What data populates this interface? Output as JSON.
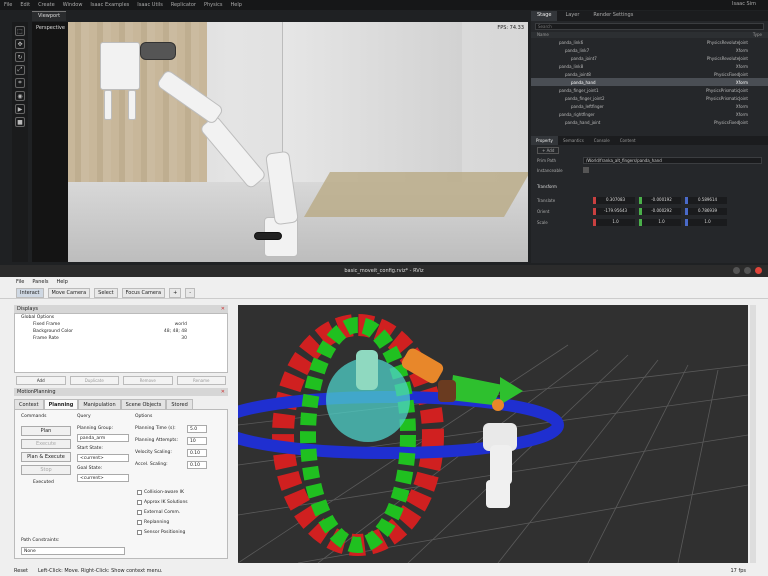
{
  "sim": {
    "menu": [
      "File",
      "Edit",
      "Create",
      "Window",
      "Isaac Examples",
      "Isaac Utils",
      "Replicator",
      "Physics",
      "Help"
    ],
    "menu_right": [
      "Isaac Sim"
    ],
    "viewport_tab": "Viewport",
    "viewport_camera": "Perspective",
    "viewport_fps": "FPS: 74.33",
    "tools": [
      "select",
      "move",
      "rotate",
      "scale",
      "snap",
      "camera",
      "play",
      "stop"
    ],
    "stage": {
      "tabs": [
        "Stage",
        "Layer",
        "Render Settings"
      ],
      "active_tab": "Stage",
      "search_placeholder": "Search",
      "col_name": "Name",
      "col_type": "Type",
      "rows": [
        {
          "name": "panda_link6",
          "type": "PhysicsRevoluteJoint",
          "sel": false
        },
        {
          "name": "panda_link7",
          "type": "Xform",
          "sel": false
        },
        {
          "name": "panda_joint7",
          "type": "PhysicsRevoluteJoint",
          "sel": false
        },
        {
          "name": "panda_link8",
          "type": "Xform",
          "sel": false
        },
        {
          "name": "panda_joint8",
          "type": "PhysicsFixedJoint",
          "sel": false
        },
        {
          "name": "panda_hand",
          "type": "Xform",
          "sel": true
        },
        {
          "name": "panda_finger_joint1",
          "type": "PhysicsPrismaticJoint",
          "sel": false
        },
        {
          "name": "panda_finger_joint2",
          "type": "PhysicsPrismaticJoint",
          "sel": false
        },
        {
          "name": "panda_leftfinger",
          "type": "Xform",
          "sel": false
        },
        {
          "name": "panda_rightfinger",
          "type": "Xform",
          "sel": false
        },
        {
          "name": "panda_hand_joint",
          "type": "PhysicsFixedJoint",
          "sel": false
        }
      ]
    },
    "property": {
      "tabs": [
        "Property",
        "Semantics",
        "Console",
        "Content"
      ],
      "active_tab": "Property",
      "add_button": "+ Add",
      "name_label": "Prim Path",
      "name_value": "/World/franka_alt_fingers/panda_hand",
      "instanceable_label": "Instanceable",
      "transform_section": "Transform",
      "translate_label": "Translate",
      "orient_label": "Orient",
      "scale_label": "Scale",
      "translate": [
        "0.307083",
        "-0.000192",
        "0.589614"
      ],
      "orient": [
        "-179.95643",
        "-0.000292",
        "0.786939"
      ],
      "scale": [
        "1.0",
        "1.0",
        "1.0"
      ]
    }
  },
  "rviz": {
    "title": "basic_moveit_config.rviz* - RViz",
    "menu": [
      "File",
      "Panels",
      "Help"
    ],
    "tools": [
      "Interact",
      "Move Camera",
      "Select",
      "Focus Camera",
      "+",
      "-"
    ],
    "displays_title": "Displays",
    "displays": [
      {
        "name": "Global Options",
        "value": ""
      },
      {
        "name": "Fixed Frame",
        "value": "world"
      },
      {
        "name": "Background Color",
        "value": "48; 48; 48"
      },
      {
        "name": "Frame Rate",
        "value": "30"
      }
    ],
    "display_buttons": [
      "Add",
      "Duplicate",
      "Remove",
      "Rename"
    ],
    "motion_title": "MotionPlanning",
    "mp_tabs": [
      "Context",
      "Planning",
      "Manipulation",
      "Scene Objects",
      "Stored"
    ],
    "mp_active_tab": "Planning",
    "commands_label": "Commands",
    "query_label": "Query",
    "options_label": "Options",
    "plan_button": "Plan",
    "execute_button": "Execute",
    "plan_execute_button": "Plan & Execute",
    "stop_button": "Stop",
    "executed_label": "Executed",
    "planning_group_label": "Planning Group:",
    "planning_group_value": "panda_arm",
    "start_state_label": "Start State:",
    "start_state_value": "<current>",
    "goal_state_label": "Goal State:",
    "goal_state_value": "<current>",
    "planning_time_label": "Planning Time (s):",
    "planning_time_value": "5.0",
    "planning_attempts_label": "Planning Attempts:",
    "planning_attempts_value": "10",
    "velocity_label": "Velocity Scaling:",
    "velocity_value": "0.10",
    "accel_label": "Accel. Scaling:",
    "accel_value": "0.10",
    "checkboxes": [
      "Collision-aware IK",
      "Approx IK Solutions",
      "External Comm.",
      "Replanning",
      "Sensor Positioning"
    ],
    "path_constraints_label": "Path Constraints:",
    "path_constraints_value": "None",
    "status_left": "Reset",
    "status_text": "Left-Click: Move. Right-Click: Show context menu.",
    "fps": "17 fps"
  }
}
